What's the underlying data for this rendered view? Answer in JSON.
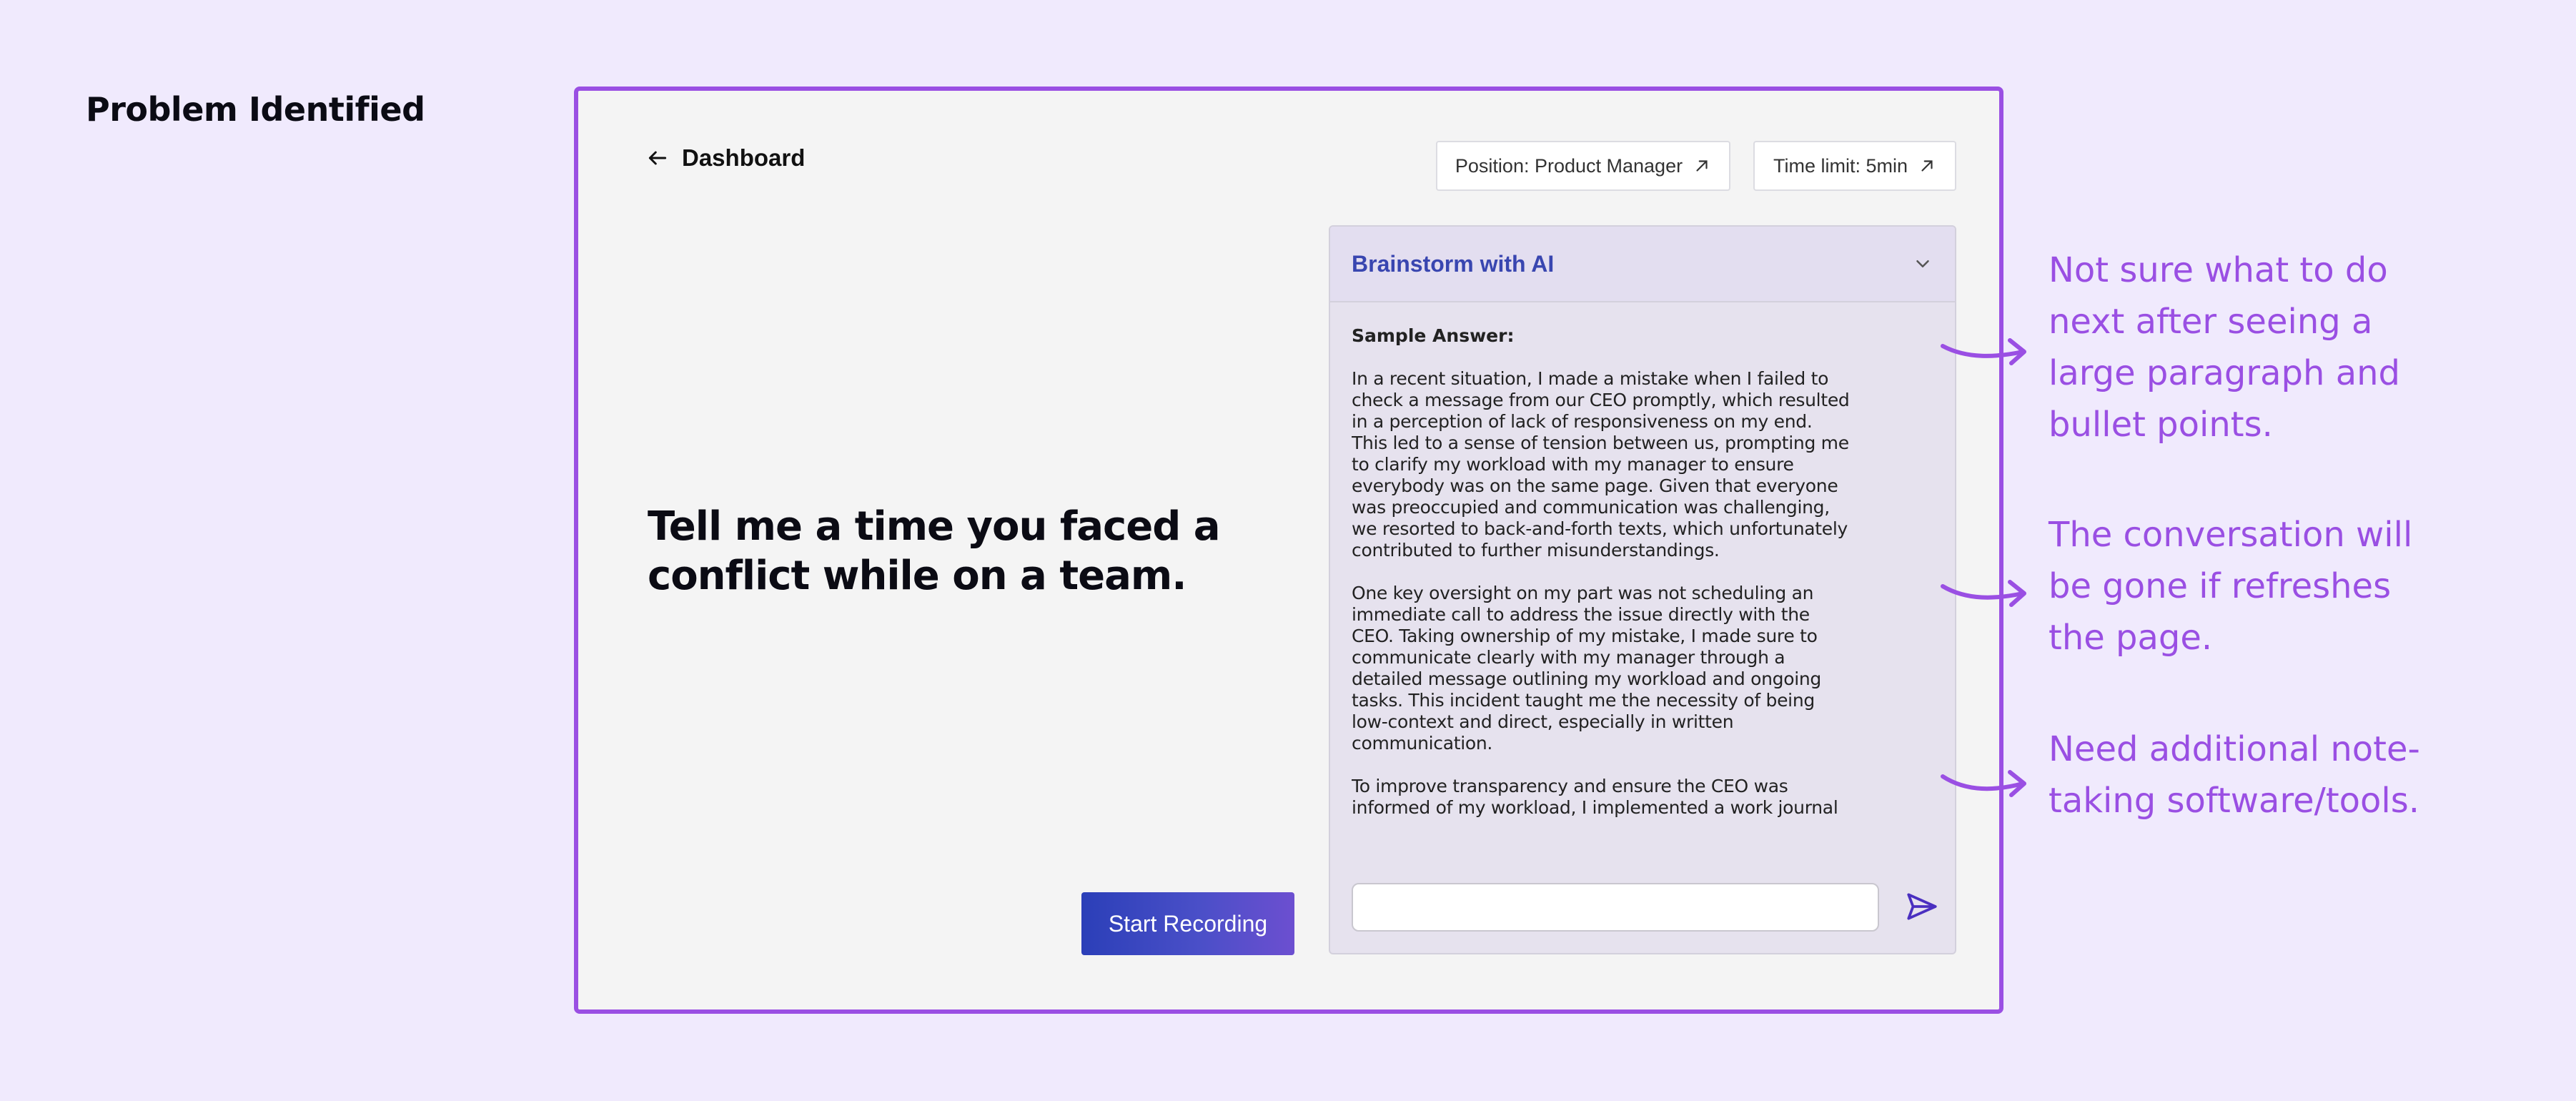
{
  "section_title": "Problem Identified",
  "header": {
    "back_label": "Dashboard",
    "position_chip": "Position: Product Manager",
    "time_chip": "Time limit: 5min"
  },
  "question": "Tell me a time you faced a conflict while on a team.",
  "record_button": "Start Recording",
  "ai_panel": {
    "title": "Brainstorm with AI",
    "sample_label": "Sample Answer:",
    "paragraphs": [
      "In a recent situation, I made a mistake when I failed to check a message from our CEO promptly, which resulted in a perception of lack of responsiveness on my end. This led to a sense of tension between us, prompting me to clarify my workload with my manager to ensure everybody was on the same page. Given that everyone was preoccupied and communication was challenging, we resorted to back-and-forth texts, which unfortunately contributed to further misunderstandings.",
      "One key oversight on my part was not scheduling an immediate call to address the issue directly with the CEO. Taking ownership of my mistake, I made sure to communicate clearly with my manager through a detailed message outlining my workload and ongoing tasks. This incident taught me the necessity of being low-context and direct, especially in written communication.",
      "To improve transparency and ensure the CEO was informed of my workload, I implemented a work journal that outlines the projects I'm currently handling. This step aimed to provide visibility into my tasks and priorities since the CEO might not be aware of the full scope of my responsibilities. Through this experience, I"
    ],
    "input_value": ""
  },
  "annotations": [
    "Not sure what to do next after seeing a large paragraph and bullet points.",
    "The conversation will be gone if refreshes the page.",
    "Need additional note-taking software/tools."
  ],
  "colors": {
    "background": "#f0eafd",
    "frame_border": "#9a4fe3",
    "annotation_text": "#9a4fe3",
    "panel_title": "#3946b0",
    "button_gradient_start": "#2b3fb8",
    "button_gradient_end": "#6c4fd0"
  },
  "icons": {
    "back": "arrow-left-icon",
    "chip": "arrow-up-right-icon",
    "collapse": "chevron-down-icon",
    "send": "send-icon",
    "annotation": "curved-arrow-icon"
  }
}
